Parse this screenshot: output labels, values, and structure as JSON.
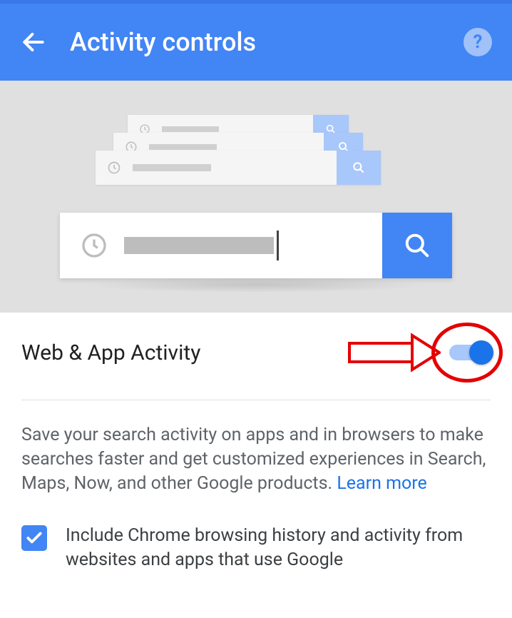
{
  "header": {
    "title": "Activity controls",
    "help_label": "?"
  },
  "section": {
    "title": "Web & App Activity",
    "toggle_on": true,
    "description": "Save your search activity on apps and in browsers to make searches faster and get customized experiences in Search, Maps, Now, and other Google products. ",
    "learn_more": "Learn more",
    "checkbox": {
      "checked": true,
      "label": "Include Chrome browsing history and activity from websites and apps that use Google"
    }
  },
  "annotations": {
    "arrow_color": "#e30000",
    "circle_color": "#e30000"
  }
}
